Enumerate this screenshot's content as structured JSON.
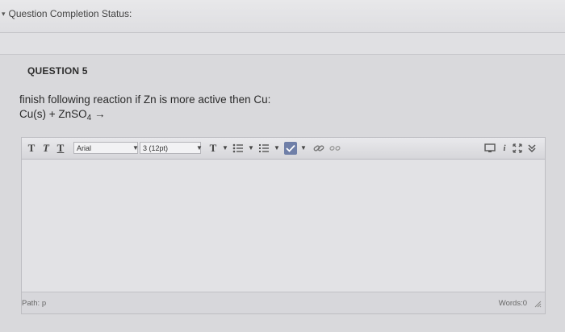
{
  "status": {
    "label": "Question Completion Status:",
    "icon": "collapse-arrow-icon"
  },
  "question": {
    "header": "QUESTION 5",
    "text": "finish following reaction if Zn is more active then Cu:",
    "equation_prefix": "Cu(s) + ZnSO",
    "equation_sub": "4",
    "equation_arrow": "→"
  },
  "editor": {
    "toolbar": {
      "bold_label": "T",
      "italic_label": "T",
      "underline_label": "T",
      "font_family": "Arial",
      "font_size": "3 (12pt)",
      "text_color_label": "T",
      "dropdown_glyph": "▼",
      "icons": [
        "text-color-icon",
        "bulleted-list-icon",
        "numbered-list-icon",
        "spellcheck-icon",
        "link-icon",
        "unlink-icon",
        "preview-icon",
        "info-icon",
        "fullscreen-icon",
        "expand-toolbar-icon"
      ]
    },
    "path_label": "Path: p",
    "words_label": "Words:0"
  }
}
